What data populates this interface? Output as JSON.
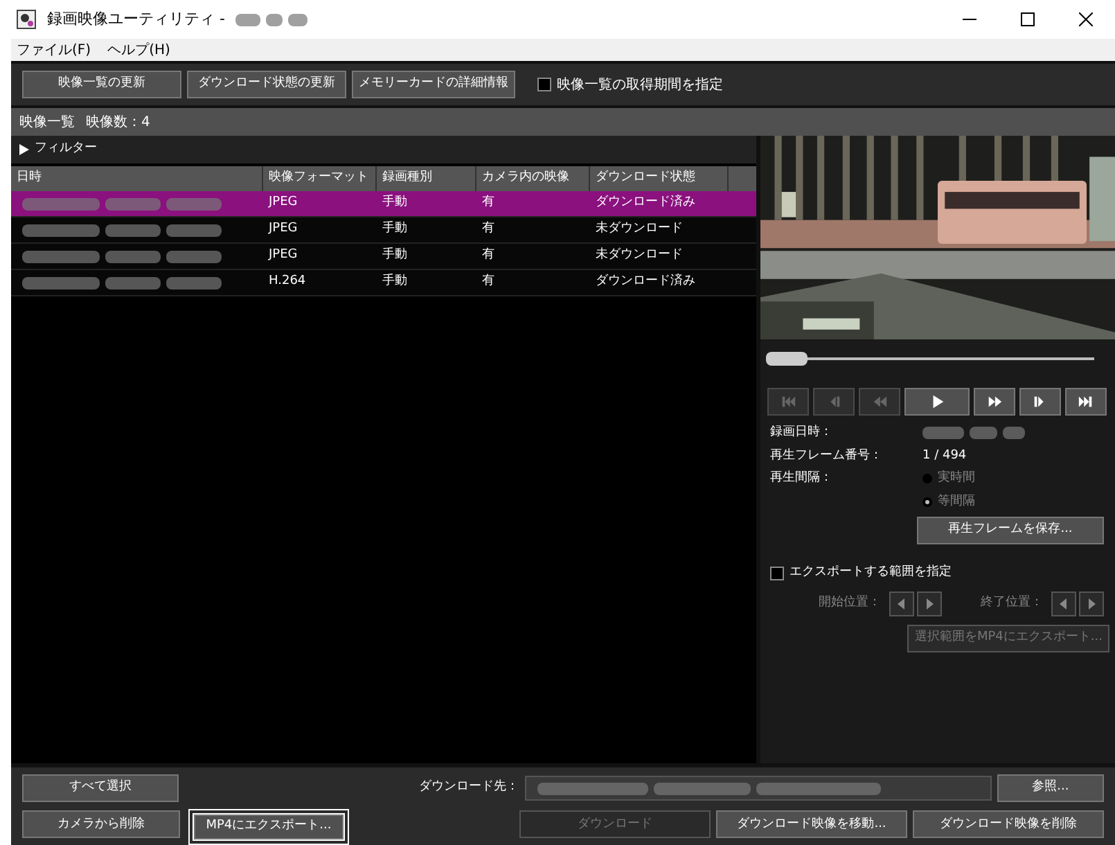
{
  "window": {
    "title": "録画映像ユーティリティ -"
  },
  "menu": [
    "ファイル(F)",
    "ヘルプ(H)"
  ],
  "toolbar": {
    "buttons": [
      "映像一覧の更新",
      "ダウンロード状態の更新",
      "メモリーカードの詳細情報"
    ],
    "period_checkbox": {
      "label": "映像一覧の取得期間を指定",
      "checked": false
    }
  },
  "list_header": {
    "title": "映像一覧",
    "count": "映像数：4"
  },
  "filter": {
    "label": "フィルター",
    "expanded": false
  },
  "table": {
    "columns": [
      "日時",
      "映像フォーマット",
      "録画種別",
      "カメラ内の映像",
      "ダウンロード状態"
    ],
    "rows": [
      {
        "selected": true,
        "cells": [
          "",
          "JPEG",
          "手動",
          "有",
          "ダウンロード済み"
        ]
      },
      {
        "selected": false,
        "cells": [
          "",
          "JPEG",
          "手動",
          "有",
          "未ダウンロード"
        ]
      },
      {
        "selected": false,
        "cells": [
          "",
          "JPEG",
          "手動",
          "有",
          "未ダウンロード"
        ]
      },
      {
        "selected": false,
        "cells": [
          "",
          "H.264",
          "手動",
          "有",
          "ダウンロード済み"
        ]
      }
    ]
  },
  "player": {
    "seek": {
      "level": 0.08
    },
    "transport": [
      {
        "kind": "first",
        "disabled": true
      },
      {
        "kind": "step_back",
        "disabled": true
      },
      {
        "kind": "rewind",
        "disabled": true
      },
      {
        "kind": "play",
        "disabled": false
      },
      {
        "kind": "forward",
        "disabled": false
      },
      {
        "kind": "step_forward",
        "disabled": false
      },
      {
        "kind": "last",
        "disabled": false
      }
    ],
    "recorded_label": "録画日時：",
    "frame_label": "再生フレーム番号：",
    "frame_value": "1 / 494",
    "interval_label": "再生間隔：",
    "interval_options": [
      {
        "label": "実時間",
        "selected": false
      },
      {
        "label": "等間隔",
        "selected": true
      }
    ],
    "save_frame": "再生フレームを保存...",
    "range_checkbox": {
      "label": "エクスポートする範囲を指定",
      "checked": false
    },
    "start_label": "開始位置：",
    "end_label": "終了位置：",
    "export_range": {
      "label": "選択範囲をMP4にエクスポート...",
      "disabled": true
    }
  },
  "bottom": {
    "select_all": "すべて選択",
    "delete_camera": "カメラから削除",
    "export_mp4": {
      "label": "MP4にエクスポート...",
      "focused": true
    },
    "dest_label": "ダウンロード先：",
    "browse": "参照...",
    "download": {
      "label": "ダウンロード",
      "disabled": true
    },
    "move": "ダウンロード映像を移動...",
    "delete_downloaded": "ダウンロード映像を削除"
  }
}
